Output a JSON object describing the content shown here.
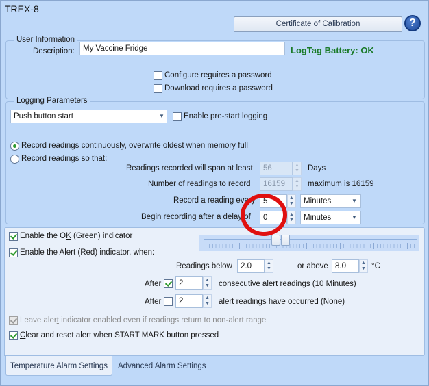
{
  "window": {
    "title": "TREX-8"
  },
  "header": {
    "certificate_button": "Certificate of Calibration",
    "help_icon": "?"
  },
  "user_information": {
    "legend": "User Information",
    "description_label": "Description:",
    "description_value": "My Vaccine Fridge",
    "battery_status": "LogTag Battery: OK",
    "configure_password": {
      "label": "Configure requires a password",
      "checked": false
    },
    "download_password": {
      "label": "Download requires a password",
      "checked": false
    }
  },
  "logging_parameters": {
    "legend": "Logging Parameters",
    "start_mode": "Push button start",
    "prestart_logging": {
      "label": "Enable pre-start logging",
      "checked": false
    },
    "mode_continuous": {
      "label": "Record readings continuously, overwrite oldest when memory full",
      "selected": true
    },
    "mode_so_that": {
      "label": "Record readings so that:",
      "selected": false
    },
    "span_label": "Readings recorded will span at least",
    "span_value": "56",
    "span_unit": "Days",
    "count_label": "Number of readings to record",
    "count_value": "16159",
    "count_max": "maximum is 16159",
    "interval_label": "Record a reading every",
    "interval_value": "5",
    "interval_unit": "Minutes",
    "delay_label": "Begin recording after a delay of",
    "delay_value": "0",
    "delay_unit": "Minutes"
  },
  "alarm_settings": {
    "ok_indicator": {
      "label": "Enable the OK (Green) indicator",
      "checked": true
    },
    "alert_indicator": {
      "label": "Enable the Alert (Red) indicator, when:",
      "checked": true
    },
    "readings_below_label": "Readings below",
    "readings_below_value": "2.0",
    "or_above_label": "or above",
    "or_above_value": "8.0",
    "temp_unit": "°C",
    "after1": {
      "label": "After",
      "checked": true,
      "value": "2",
      "desc": "consecutive alert readings (10 Minutes)"
    },
    "after2": {
      "label": "After",
      "checked": false,
      "value": "2",
      "desc": "alert readings have occurred (None)"
    },
    "leave_alert": {
      "label": "Leave alert indicator enabled even if readings return to non-alert range",
      "checked": true,
      "disabled": true
    },
    "clear_reset": {
      "label": "Clear and reset alert when START MARK button pressed",
      "checked": true
    }
  },
  "tabs": [
    {
      "label": "Temperature Alarm Settings",
      "active": true
    },
    {
      "label": "Advanced Alarm Settings",
      "active": false
    }
  ],
  "colors": {
    "background": "#bfd9f9",
    "battery_ok": "#1a7a28",
    "annotation": "#e01010"
  }
}
